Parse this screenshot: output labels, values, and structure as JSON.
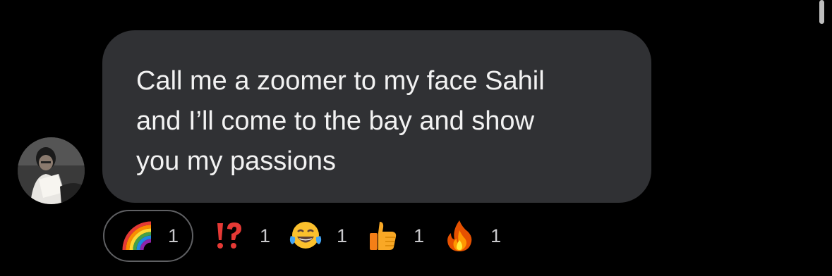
{
  "message": {
    "text": "Call me a zoomer to my face Sahil\nand I’ll come to the bay and show\nyou my passions"
  },
  "reactions": [
    {
      "emoji": "rainbow-icon",
      "count": "1",
      "selected": true
    },
    {
      "emoji": "exclamation-question-icon",
      "count": "1",
      "selected": false
    },
    {
      "emoji": "tears-of-joy-icon",
      "count": "1",
      "selected": false
    },
    {
      "emoji": "thumbs-up-icon",
      "count": "1",
      "selected": false
    },
    {
      "emoji": "fire-icon",
      "count": "1",
      "selected": false
    }
  ],
  "colors": {
    "background": "#000000",
    "bubble": "#303134",
    "text": "#f2f2f2",
    "count": "#c9c9cc",
    "selected_border": "#5f6063"
  }
}
